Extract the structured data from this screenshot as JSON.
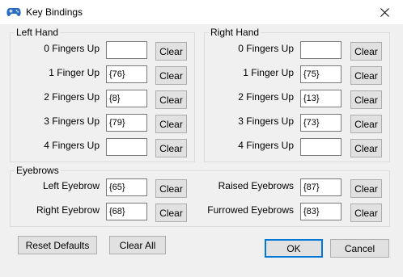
{
  "window": {
    "title": "Key Bindings",
    "icon": "gamepad-icon"
  },
  "left_hand": {
    "title": "Left Hand",
    "rows": [
      {
        "label": "0 Fingers Up",
        "value": "",
        "clear": "Clear"
      },
      {
        "label": "1 Finger Up",
        "value": "{76}",
        "clear": "Clear"
      },
      {
        "label": "2 Fingers Up",
        "value": "{8}",
        "clear": "Clear"
      },
      {
        "label": "3 Fingers Up",
        "value": "{79}",
        "clear": "Clear"
      },
      {
        "label": "4 Fingers Up",
        "value": "",
        "clear": "Clear"
      }
    ]
  },
  "right_hand": {
    "title": "Right Hand",
    "rows": [
      {
        "label": "0 Fingers Up",
        "value": "",
        "clear": "Clear"
      },
      {
        "label": "1 Finger Up",
        "value": "{75}",
        "clear": "Clear"
      },
      {
        "label": "2 Fingers Up",
        "value": "{13}",
        "clear": "Clear"
      },
      {
        "label": "3 Fingers Up",
        "value": "{73}",
        "clear": "Clear"
      },
      {
        "label": "4 Fingers Up",
        "value": "",
        "clear": "Clear"
      }
    ]
  },
  "eyebrows": {
    "title": "Eyebrows",
    "left_eyebrow": {
      "label": "Left Eyebrow",
      "value": "{65}",
      "clear": "Clear"
    },
    "right_eyebrow": {
      "label": "Right Eyebrow",
      "value": "{68}",
      "clear": "Clear"
    },
    "raised": {
      "label": "Raised Eyebrows",
      "value": "{87}",
      "clear": "Clear"
    },
    "furrowed": {
      "label": "Furrowed Eyebrows",
      "value": "{83}",
      "clear": "Clear"
    }
  },
  "buttons": {
    "reset_defaults": "Reset Defaults",
    "clear_all": "Clear All",
    "ok": "OK",
    "cancel": "Cancel"
  },
  "colors": {
    "accent": "#0078d7",
    "icon": "#2b6cc4"
  }
}
